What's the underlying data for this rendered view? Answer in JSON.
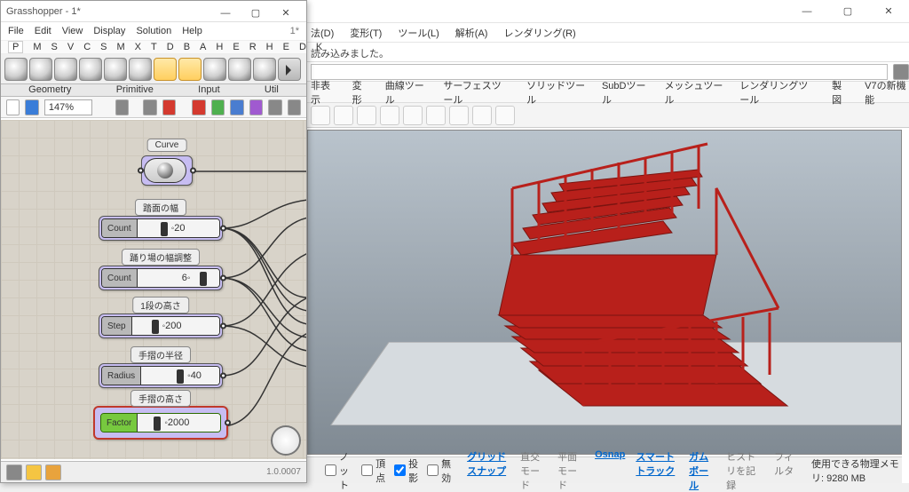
{
  "rhino": {
    "menu": [
      "法(D)",
      "変形(T)",
      "ツール(L)",
      "解析(A)",
      "レンダリング(R)"
    ],
    "cmd_out": "読み込みました。",
    "tabs": [
      "非表示",
      "変形",
      "曲線ツール",
      "サーフェスツール",
      "ソリッドツール",
      "SubDツール",
      "メッシュツール",
      "レンダリングツール",
      "製図",
      "V7の新機能"
    ],
    "status": {
      "chk1": "ノット",
      "chk2": "頂点",
      "chk3": "投影",
      "chk4": "無効",
      "links": [
        "グリッドスナップ",
        "直交モード",
        "平面モード",
        "Osnap",
        "スマートトラック",
        "ガムボール",
        "ヒストリを記録",
        "フィルタ"
      ],
      "mem": "使用できる物理メモリ: 9280 MB"
    }
  },
  "gh": {
    "title": "Grasshopper - 1*",
    "menu": [
      "File",
      "Edit",
      "View",
      "Display",
      "Solution",
      "Help"
    ],
    "doc": "1*",
    "cats": [
      "P",
      "M",
      "S",
      "V",
      "C",
      "S",
      "M",
      "X",
      "T",
      "D",
      "B",
      "A",
      "H",
      "E",
      "R",
      "H",
      "E",
      "D",
      "K"
    ],
    "ribbon_labels": [
      "Geometry",
      "Primitive",
      "Input",
      "Util"
    ],
    "zoom": "147%",
    "version": "1.0.0007",
    "nodes": {
      "curve": {
        "label": "Curve"
      },
      "count1": {
        "label": "踏面の幅",
        "name": "Count",
        "value": "20"
      },
      "count2": {
        "label": "踊り場の幅調整",
        "name": "Count",
        "value": "6"
      },
      "step": {
        "label": "1段の高さ",
        "name": "Step",
        "value": "200"
      },
      "radius": {
        "label": "手摺の半径",
        "name": "Radius",
        "value": "40"
      },
      "factor": {
        "label": "手摺の高さ",
        "name": "Factor",
        "value": "2000"
      }
    }
  }
}
